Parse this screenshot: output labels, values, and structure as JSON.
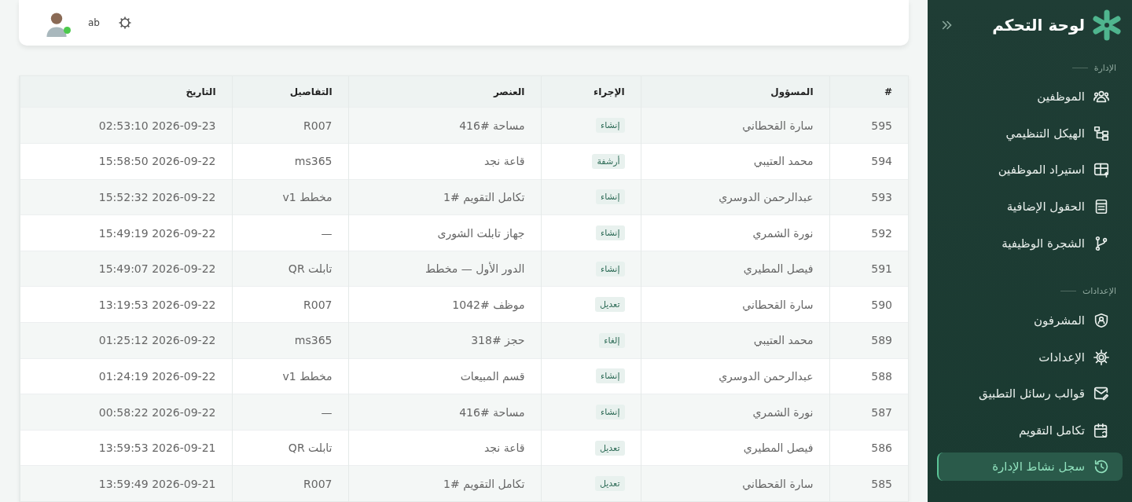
{
  "header": {
    "user_initials": "ab",
    "online": true
  },
  "table": {
    "columns": [
      "#",
      "المسؤول",
      "الإجراء",
      "العنصر",
      "التفاصيل",
      "التاريخ"
    ],
    "rows": [
      {
        "id": "595",
        "user": "سارة القحطاني",
        "action": "إنشاء",
        "item": "مساحة #416",
        "details": "R007",
        "date": "2026-09-23 02:53:10"
      },
      {
        "id": "594",
        "user": "محمد العتيبي",
        "action": "أرشفة",
        "item": "قاعة نجد",
        "details": "ms365",
        "date": "2026-09-22 15:58:50"
      },
      {
        "id": "593",
        "user": "عبدالرحمن الدوسري",
        "action": "إنشاء",
        "item": "تكامل التقويم #1",
        "details": "مخطط v1",
        "date": "2026-09-22 15:52:32"
      },
      {
        "id": "592",
        "user": "نورة الشمري",
        "action": "إنشاء",
        "item": "جهاز تابلت الشورى",
        "details": "—",
        "date": "2026-09-22 15:49:19"
      },
      {
        "id": "591",
        "user": "فيصل المطيري",
        "action": "إنشاء",
        "item": "الدور الأول — مخطط",
        "details": "تابلت QR",
        "date": "2026-09-22 15:49:07"
      },
      {
        "id": "590",
        "user": "سارة القحطاني",
        "action": "تعديل",
        "item": "موظف #1042",
        "details": "R007",
        "date": "2026-09-22 13:19:53"
      },
      {
        "id": "589",
        "user": "محمد العتيبي",
        "action": "إلغاء",
        "item": "حجز #318",
        "details": "ms365",
        "date": "2026-09-22 01:25:12"
      },
      {
        "id": "588",
        "user": "عبدالرحمن الدوسري",
        "action": "إنشاء",
        "item": "قسم المبيعات",
        "details": "مخطط v1",
        "date": "2026-09-22 01:24:19"
      },
      {
        "id": "587",
        "user": "نورة الشمري",
        "action": "إنشاء",
        "item": "مساحة #416",
        "details": "—",
        "date": "2026-09-22 00:58:22"
      },
      {
        "id": "586",
        "user": "فيصل المطيري",
        "action": "تعديل",
        "item": "قاعة نجد",
        "details": "تابلت QR",
        "date": "2026-09-21 13:59:53"
      },
      {
        "id": "585",
        "user": "سارة القحطاني",
        "action": "تعديل",
        "item": "تكامل التقويم #1",
        "details": "R007",
        "date": "2026-09-21 13:59:49"
      }
    ]
  },
  "sidebar": {
    "title": "لوحة التحكم",
    "sections": [
      {
        "label": "الإدارة",
        "items": [
          {
            "label": "الموظفين",
            "selected": false
          },
          {
            "label": "الهيكل التنظيمي",
            "selected": false
          },
          {
            "label": "استيراد الموظفين",
            "selected": false
          },
          {
            "label": "الحقول الإضافية",
            "selected": false
          },
          {
            "label": "الشجرة الوظيفية",
            "selected": false
          }
        ]
      },
      {
        "label": "الإعدادات",
        "items": [
          {
            "label": "المشرفون",
            "selected": false
          },
          {
            "label": "الإعدادات",
            "selected": false
          },
          {
            "label": "قوالب رسائل التطبيق",
            "selected": false
          },
          {
            "label": "تكامل التقويم",
            "selected": false
          },
          {
            "label": "سجل نشاط الإدارة",
            "selected": true
          }
        ]
      }
    ]
  }
}
